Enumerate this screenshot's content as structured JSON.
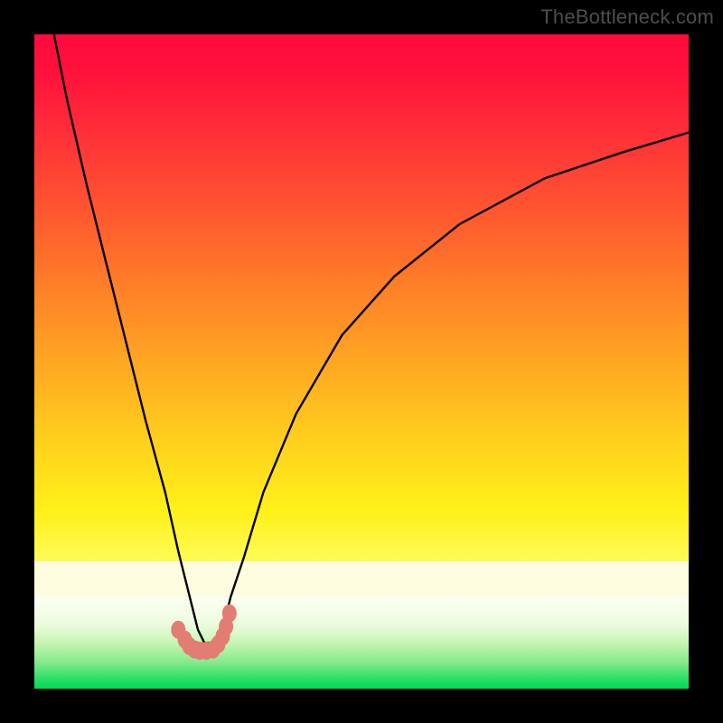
{
  "watermark": {
    "text": "TheBottleneck.com"
  },
  "colors": {
    "frame": "#000000",
    "curve_stroke": "#000000",
    "marker_fill": "#e37c72",
    "marker_stroke": "#d86a60"
  },
  "chart_data": {
    "type": "line",
    "title": "",
    "xlabel": "",
    "ylabel": "",
    "xlim": [
      0,
      100
    ],
    "ylim": [
      0,
      100
    ],
    "note": "Unlabeled axes; values are rough estimates from pixel geometry. Curve shows bottleneck magnitude vs. component-ratio-like x, with minimum around x≈26.",
    "series": [
      {
        "name": "bottleneck-curve",
        "x": [
          3,
          5,
          8,
          11,
          14,
          17,
          20,
          22,
          24,
          25,
          26,
          27,
          28,
          29,
          30,
          32,
          35,
          40,
          47,
          55,
          65,
          78,
          90,
          100
        ],
        "values": [
          100,
          90,
          77,
          65,
          53,
          41,
          30,
          21,
          13,
          9,
          7,
          7,
          8,
          10,
          14,
          20,
          30,
          42,
          54,
          63,
          71,
          78,
          82,
          85
        ]
      }
    ],
    "markers": {
      "name": "highlight-dots",
      "x": [
        22.0,
        23.0,
        23.7,
        24.5,
        25.3,
        26.3,
        27.3,
        28.1,
        28.8,
        29.3,
        29.8
      ],
      "values": [
        9.0,
        7.5,
        6.5,
        6.0,
        5.8,
        5.8,
        6.0,
        6.8,
        8.0,
        9.5,
        11.5
      ]
    }
  }
}
